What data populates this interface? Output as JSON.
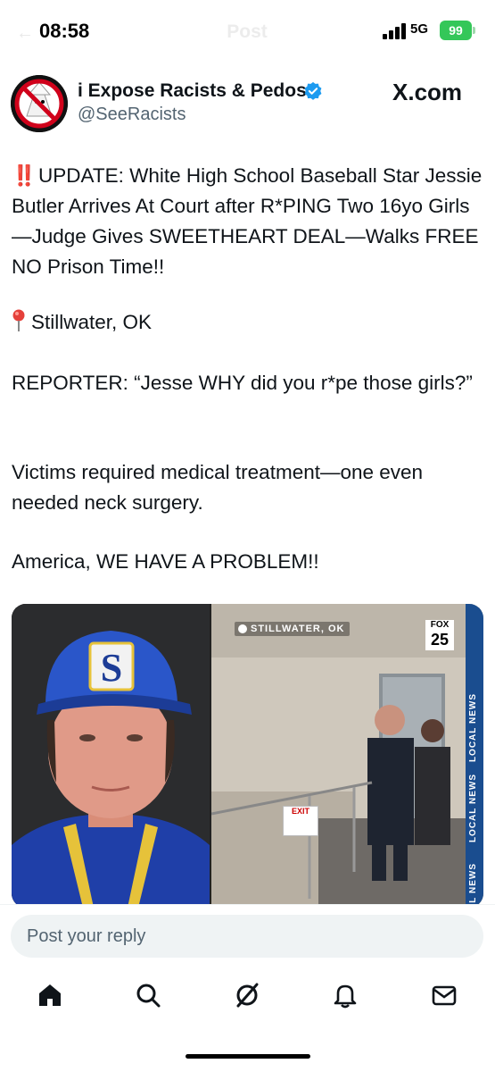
{
  "status_bar": {
    "time": "08:58",
    "ghost_title": "Post",
    "network": "5G",
    "battery": "99"
  },
  "post": {
    "author_name": "i Expose Racists & Pedos",
    "handle": "@SeeRacists",
    "source_logo": "X.com",
    "paragraphs": {
      "headline_prefix": "‼️",
      "headline": "UPDATE: White High School Baseball Star Jessie Butler Arrives At Court after R*PING Two 16yo Girls—Judge Gives SWEETHEART DEAL—Walks FREE NO Prison Time!!",
      "location": "Stillwater, OK",
      "reporter": "REPORTER: “Jesse WHY did you r*pe those girls?”",
      "victims": "Victims required medical treatment—one even needed neck surgery.",
      "closing": "America, WE HAVE A PROBLEM!!"
    },
    "media": {
      "location_tag": "STILLWATER, OK",
      "channel_top": "FOX",
      "channel_num": "25",
      "ticker_1": "LOCAL NEWS",
      "ticker_2": "LOCAL NEWS",
      "ticker_3": "L NEWS",
      "exit_sign": "EXIT"
    }
  },
  "reply": {
    "placeholder": "Post your reply"
  },
  "icons": {
    "nav": [
      "home-icon",
      "search-icon",
      "grok-icon",
      "notifications-icon",
      "messages-icon"
    ]
  },
  "colors": {
    "accent": "#1d9bf0",
    "battery": "#34c759",
    "text": "#0f1419",
    "secondary": "#536471"
  }
}
